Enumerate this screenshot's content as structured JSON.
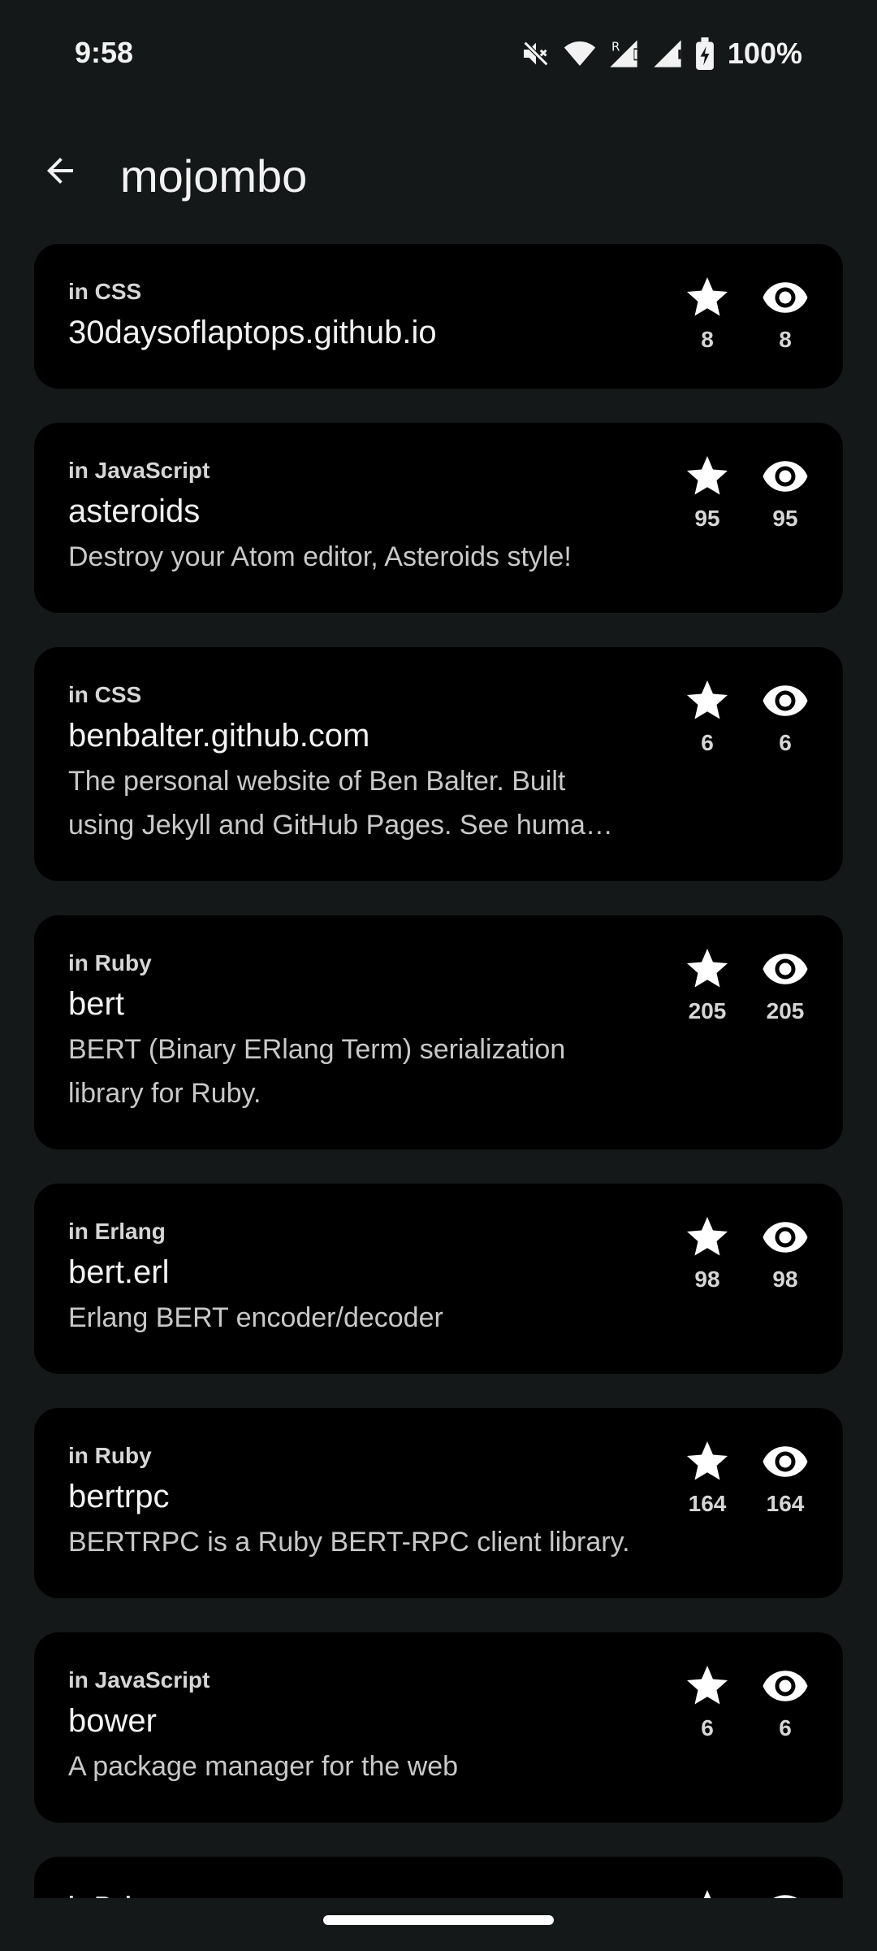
{
  "status_bar": {
    "time": "9:58",
    "battery": "100%",
    "icons": [
      "mute-icon",
      "wifi-icon",
      "signal-roaming-icon",
      "signal-icon",
      "battery-charging-icon"
    ]
  },
  "app_bar": {
    "title": "mojombo",
    "back_icon": "arrow-back-icon"
  },
  "repos": [
    {
      "language": "in CSS",
      "name": "30daysoflaptops.github.io",
      "description": "",
      "stars": "8",
      "watchers": "8"
    },
    {
      "language": "in JavaScript",
      "name": "asteroids",
      "description": "Destroy your Atom editor, Asteroids style!",
      "stars": "95",
      "watchers": "95"
    },
    {
      "language": "in CSS",
      "name": "benbalter.github.com",
      "description": "The personal website of Ben Balter. Built using Jekyll and GitHub Pages. See huma…",
      "stars": "6",
      "watchers": "6"
    },
    {
      "language": "in Ruby",
      "name": "bert",
      "description": "BERT (Binary ERlang Term) serialization library for Ruby.",
      "stars": "205",
      "watchers": "205"
    },
    {
      "language": "in Erlang",
      "name": "bert.erl",
      "description": "Erlang BERT encoder/decoder",
      "stars": "98",
      "watchers": "98"
    },
    {
      "language": "in Ruby",
      "name": "bertrpc",
      "description": "BERTRPC is a Ruby BERT-RPC client library.",
      "stars": "164",
      "watchers": "164"
    },
    {
      "language": "in JavaScript",
      "name": "bower",
      "description": "A package manager for the web",
      "stars": "6",
      "watchers": "6"
    },
    {
      "language": "in Ruby",
      "name": "",
      "description": "",
      "stars": "",
      "watchers": ""
    }
  ],
  "colors": {
    "background": "#141818",
    "card": "#000000",
    "text_primary": "#f2f2f2",
    "text_secondary": "#c8c8c8"
  }
}
